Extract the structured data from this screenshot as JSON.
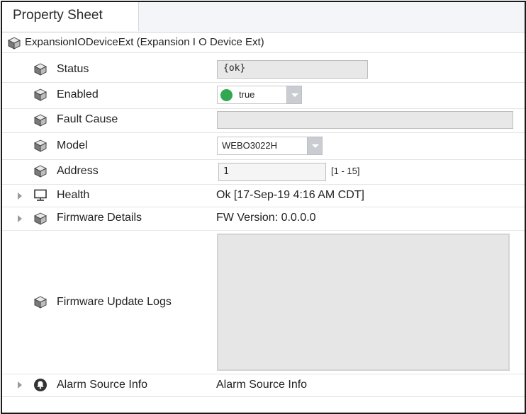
{
  "tab": {
    "label": "Property Sheet"
  },
  "header": {
    "label": "ExpansionIODeviceExt  (Expansion I O Device Ext)",
    "icon": "cube-icon"
  },
  "rows": {
    "status": {
      "label": "Status",
      "value": "{ok}"
    },
    "enabled": {
      "label": "Enabled",
      "value": "true",
      "status_color": "#2fa84f"
    },
    "fault": {
      "label": "Fault Cause",
      "value": ""
    },
    "model": {
      "label": "Model",
      "value": "WEBO3022H"
    },
    "address": {
      "label": "Address",
      "value": "1",
      "range": "[1 - 15]"
    },
    "health": {
      "label": "Health",
      "value": "Ok [17-Sep-19 4:16 AM CDT]",
      "icon": "monitor-icon"
    },
    "firmware": {
      "label": "Firmware Details",
      "value": "FW Version: 0.0.0.0"
    },
    "logs": {
      "label": "Firmware Update Logs",
      "value": ""
    },
    "alarm": {
      "label": "Alarm Source Info",
      "value": "Alarm Source Info",
      "icon": "alarm-icon"
    }
  }
}
